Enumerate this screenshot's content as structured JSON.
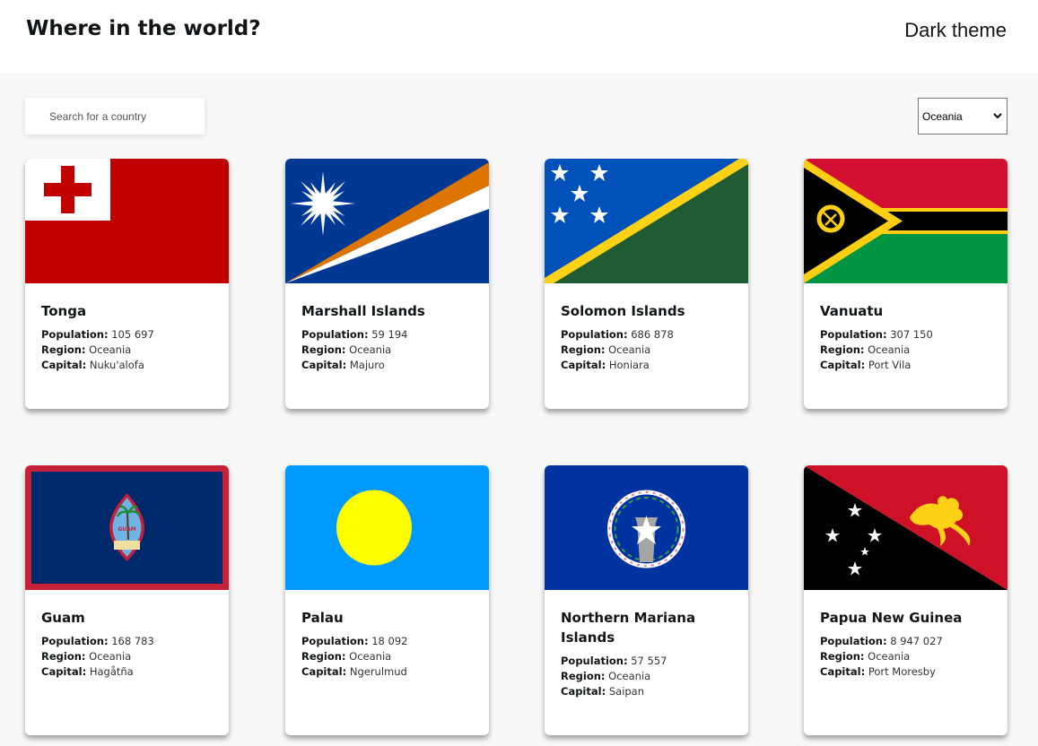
{
  "header": {
    "title": "Where in the world?",
    "theme_toggle_label": "Dark theme"
  },
  "search": {
    "placeholder": "Search for a country",
    "value": ""
  },
  "filter": {
    "selected_region": "Oceania"
  },
  "labels": {
    "population": "Population:",
    "region": "Region:",
    "capital": "Capital:"
  },
  "countries": [
    {
      "name": "Tonga",
      "population": "105 697",
      "region": "Oceania",
      "capital": "Nuku'alofa",
      "flag_icon": "tonga-flag-icon"
    },
    {
      "name": "Marshall Islands",
      "population": "59 194",
      "region": "Oceania",
      "capital": "Majuro",
      "flag_icon": "marshall-islands-flag-icon"
    },
    {
      "name": "Solomon Islands",
      "population": "686 878",
      "region": "Oceania",
      "capital": "Honiara",
      "flag_icon": "solomon-islands-flag-icon"
    },
    {
      "name": "Vanuatu",
      "population": "307 150",
      "region": "Oceania",
      "capital": "Port Vila",
      "flag_icon": "vanuatu-flag-icon"
    },
    {
      "name": "Guam",
      "population": "168 783",
      "region": "Oceania",
      "capital": "Hagåtña",
      "flag_icon": "guam-flag-icon"
    },
    {
      "name": "Palau",
      "population": "18 092",
      "region": "Oceania",
      "capital": "Ngerulmud",
      "flag_icon": "palau-flag-icon"
    },
    {
      "name": "Northern Mariana Islands",
      "population": "57 557",
      "region": "Oceania",
      "capital": "Saipan",
      "flag_icon": "northern-mariana-islands-flag-icon"
    },
    {
      "name": "Papua New Guinea",
      "population": "8 947 027",
      "region": "Oceania",
      "capital": "Port Moresby",
      "flag_icon": "papua-new-guinea-flag-icon"
    }
  ]
}
